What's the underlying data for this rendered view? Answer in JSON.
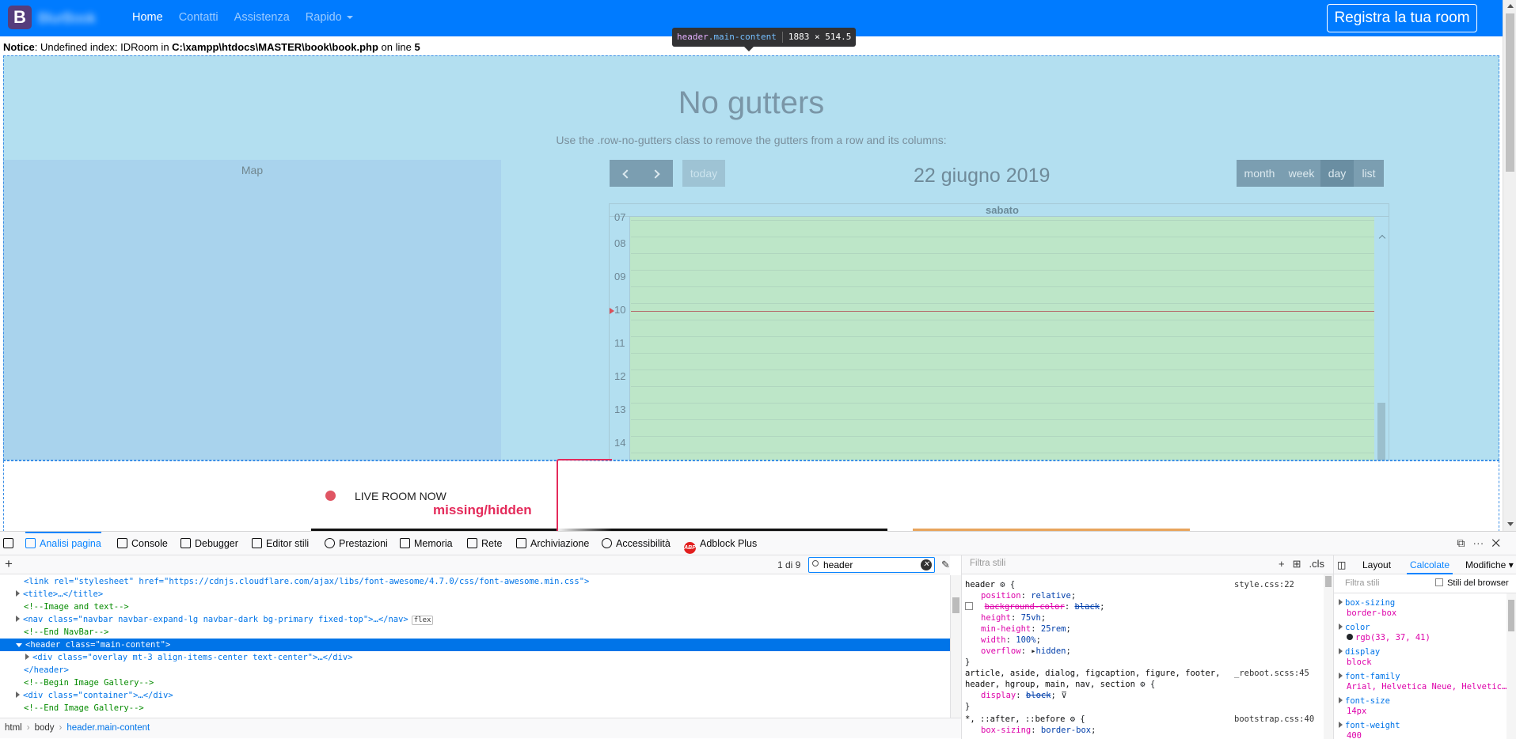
{
  "navbar": {
    "brand_letter": "B",
    "brand_text": "BlurBook",
    "links": [
      "Home",
      "Contatti",
      "Assistenza",
      "Rapido"
    ],
    "register_button": "Registra la tua room"
  },
  "notice": {
    "label": "Notice",
    "message": ": Undefined index: IDRoom in ",
    "path": "C:\\xampp\\htdocs\\MASTER\\book\\book.php",
    "line_text": " on line ",
    "line": "5"
  },
  "tooltip": {
    "tag": "header",
    "class": ".main-content",
    "size": "1883 × 514.5"
  },
  "header": {
    "title": "No gutters",
    "subtitle": "Use the .row-no-gutters class to remove the gutters from a row and its columns:",
    "map_label": "Map"
  },
  "calendar": {
    "today_label": "today",
    "date": "22 giugno 2019",
    "views": [
      "month",
      "week",
      "day",
      "list"
    ],
    "active_view": "day",
    "day_header": "sabato",
    "hours": [
      "07",
      "08",
      "09",
      "10",
      "11",
      "12",
      "13",
      "14"
    ]
  },
  "live": {
    "label": "LIVE ROOM NOW"
  },
  "annotation": {
    "text": "missing/hidden",
    "color": "#e42b5b"
  },
  "devtools": {
    "tabs": [
      "Analisi pagina",
      "Console",
      "Debugger",
      "Editor stili",
      "Prestazioni",
      "Memoria",
      "Rete",
      "Archiviazione",
      "Accessibilità",
      "Adblock Plus"
    ],
    "active_tab": "Analisi pagina",
    "search": {
      "match_count": "1 di 9",
      "value": "header"
    },
    "markup_lines": [
      {
        "text": "<link rel=\"stylesheet\" href=\"https://cdnjs.cloudflare.com/ajax/libs/font-awesome/4.7.0/css/font-awesome.min.css\">"
      },
      {
        "text": "<title>…</title>"
      },
      {
        "text": "<!--Image and text-->"
      },
      {
        "text": "<nav class=\"navbar navbar-expand-lg navbar-dark bg-primary fixed-top\">…</nav>",
        "badge": "flex"
      },
      {
        "text": "<!--End NavBar-->"
      },
      {
        "text": "<header class=\"main-content\">"
      },
      {
        "text": "<div class=\"overlay mt-3 align-items-center text-center\">…</div>"
      },
      {
        "text": "</header>"
      },
      {
        "text": "<!--Begin Image Gallery-->"
      },
      {
        "text": "<div class=\"container\">…</div>"
      },
      {
        "text": "<!--End Image Gallery-->"
      }
    ],
    "breadcrumb": [
      "html",
      "body",
      "header.main-content"
    ],
    "rules": {
      "filter_placeholder": "Filtra stili",
      "cls_label": ".cls",
      "blocks": [
        {
          "selector": "header",
          "source": "style.css:22",
          "props": [
            {
              "name": "position",
              "value": "relative"
            },
            {
              "name": "background-color",
              "value": "black",
              "disabled": true
            },
            {
              "name": "height",
              "value": "75vh"
            },
            {
              "name": "min-height",
              "value": "25rem"
            },
            {
              "name": "width",
              "value": "100%"
            },
            {
              "name": "overflow",
              "value": "hidden"
            }
          ]
        },
        {
          "selector": "article, aside, dialog, figcaption, figure, footer,",
          "selector2": "header, hgroup, main, nav, section",
          "source": "_reboot.scss:45",
          "props": [
            {
              "name": "display",
              "value": "block",
              "overridden": true
            }
          ]
        },
        {
          "selector": "*, ::after, ::before",
          "source": "bootstrap.css:40",
          "props": [
            {
              "name": "box-sizing",
              "value": "border-box"
            }
          ]
        }
      ]
    },
    "computed": {
      "tabs": [
        "Layout",
        "Calcolate",
        "Modifiche"
      ],
      "active_tab": "Calcolate",
      "filter_placeholder": "Filtra stili",
      "browser_styles_label": "Stili del browser",
      "props": [
        {
          "name": "box-sizing",
          "value": "border-box"
        },
        {
          "name": "color",
          "value": "rgb(33, 37, 41)"
        },
        {
          "name": "display",
          "value": "block"
        },
        {
          "name": "font-family",
          "value": "Arial, Helvetica Neue, Helvetic…"
        },
        {
          "name": "font-size",
          "value": "14px"
        },
        {
          "name": "font-weight",
          "value": "400"
        }
      ]
    }
  }
}
